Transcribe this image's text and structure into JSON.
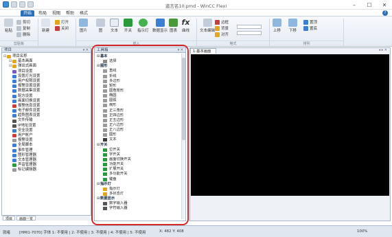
{
  "titlebar": {
    "title": "道言名10.pmd - WinCC Flexi",
    "buttons": [
      "–",
      "☐",
      "✕"
    ]
  },
  "tabs": [
    "开始",
    "布局",
    "视图",
    "帮助",
    "格式"
  ],
  "ribbon": {
    "clipboard": [
      "粘贴",
      "剪切",
      "复制",
      "删除"
    ],
    "project": [
      "新建",
      "打开",
      "关闭"
    ],
    "insert": [
      "图片",
      "图",
      "文本",
      "开关",
      "指示灯",
      "数据显示",
      "图表",
      "曲线"
    ],
    "fx": "fx",
    "format": [
      "文本编辑",
      "边框",
      "背景",
      "对齐"
    ],
    "arrange": [
      "上移",
      "下移",
      "置顶",
      "置底"
    ],
    "groups": [
      "剪贴板",
      "插入",
      "格式",
      "排列"
    ]
  },
  "left_panel": {
    "title": "项目",
    "items": [
      {
        "text": "项目名称",
        "level": 0,
        "color": "#e3a51b"
      },
      {
        "text": "基本画面",
        "level": 1,
        "color": "#e3a51b"
      },
      {
        "text": "弹出式画面",
        "level": 1,
        "color": "#e3a51b"
      },
      {
        "text": "项目设置",
        "level": 1,
        "color": "#7a5bb8"
      },
      {
        "text": "设置灯光设置",
        "level": 1,
        "color": "#3a7fd1"
      },
      {
        "text": "用户权限设置",
        "level": 1,
        "color": "#3a7fd1"
      },
      {
        "text": "报警设置设置",
        "level": 1,
        "color": "#3a7fd1"
      },
      {
        "text": "数据采集设置",
        "level": 1,
        "color": "#3a7fd1"
      },
      {
        "text": "配方设置",
        "level": 1,
        "color": "#3a7fd1"
      },
      {
        "text": "画面切换设置",
        "level": 1,
        "color": "#3a7fd1"
      },
      {
        "text": "报警信息设置",
        "level": 1,
        "color": "#c63d3d"
      },
      {
        "text": "电子邮件设置",
        "level": 1,
        "color": "#3a7fd1"
      },
      {
        "text": "趋势图表设置",
        "level": 1,
        "color": "#3a7fd1"
      },
      {
        "text": "文件传输",
        "level": 1,
        "color": "#555555"
      },
      {
        "text": "IP地址设置",
        "level": 1,
        "color": "#555555"
      },
      {
        "text": "安全设置",
        "level": 1,
        "color": "#3a7fd1"
      },
      {
        "text": "用户帐户",
        "level": 1,
        "color": "#c63d3d"
      },
      {
        "text": "报警设置",
        "level": 1,
        "color": "#999999"
      },
      {
        "text": "全局脚本",
        "level": 1,
        "color": "#3a7fd1"
      },
      {
        "text": "事件管理",
        "level": 1,
        "color": "#3a7fd1"
      },
      {
        "text": "图形管理器",
        "level": 1,
        "color": "#3a7fd1"
      },
      {
        "text": "文本管理器",
        "level": 1,
        "color": "#3a7fd1"
      },
      {
        "text": "声音管理器",
        "level": 1,
        "color": "#2a9a3a"
      },
      {
        "text": "标记编辑器",
        "level": 1,
        "color": "#999999"
      }
    ],
    "bottom_tabs": [
      "项目",
      "画面一览"
    ]
  },
  "toolbox": {
    "title": "工具箱",
    "rows": [
      {
        "text": "基本",
        "cat": true
      },
      {
        "text": "选择",
        "cat": false,
        "color": "#888888"
      },
      {
        "text": "图形",
        "cat": true
      },
      {
        "text": "直线",
        "cat": false,
        "color": "#999999"
      },
      {
        "text": "折线",
        "cat": false,
        "color": "#999999"
      },
      {
        "text": "多边形",
        "cat": false,
        "color": "#999999"
      },
      {
        "text": "矩形",
        "cat": false,
        "color": "#999999"
      },
      {
        "text": "圆角矩形",
        "cat": false,
        "color": "#999999"
      },
      {
        "text": "椭圆",
        "cat": false,
        "color": "#999999"
      },
      {
        "text": "圆弧",
        "cat": false,
        "color": "#999999"
      },
      {
        "text": "扇形",
        "cat": false,
        "color": "#999999"
      },
      {
        "text": "正三角形",
        "cat": false,
        "color": "#999999"
      },
      {
        "text": "正四边形",
        "cat": false,
        "color": "#999999"
      },
      {
        "text": "正五边形",
        "cat": false,
        "color": "#999999"
      },
      {
        "text": "正六边形",
        "cat": false,
        "color": "#999999"
      },
      {
        "text": "正八边形",
        "cat": false,
        "color": "#999999"
      },
      {
        "text": "圆形",
        "cat": false,
        "color": "#999999"
      },
      {
        "text": "文本",
        "cat": false,
        "color": "#3a3a3a"
      },
      {
        "text": "开关",
        "cat": true
      },
      {
        "text": "位开关",
        "cat": false,
        "color": "#2a9a3a"
      },
      {
        "text": "字开关",
        "cat": false,
        "color": "#2a9a3a"
      },
      {
        "text": "画面切换开关",
        "cat": false,
        "color": "#2a9a3a"
      },
      {
        "text": "功能开关",
        "cat": false,
        "color": "#2a9a3a"
      },
      {
        "text": "扩展开关",
        "cat": false,
        "color": "#2a9a3a"
      },
      {
        "text": "多功能开关",
        "cat": false,
        "color": "#2a9a3a"
      },
      {
        "text": "键盘",
        "cat": false,
        "color": "#2a9a3a"
      },
      {
        "text": "指示灯",
        "cat": true
      },
      {
        "text": "指示灯",
        "cat": false,
        "color": "#e3a51b"
      },
      {
        "text": "多状态灯",
        "cat": false,
        "color": "#e3a51b"
      },
      {
        "text": "数据显示",
        "cat": true
      },
      {
        "text": "数字输入器",
        "cat": false,
        "color": "#555555"
      },
      {
        "text": "字符输入器",
        "cat": false,
        "color": "#555555"
      }
    ]
  },
  "editor": {
    "tab": "1:基本画面",
    "ctrls": "◂ ▸ ✕"
  },
  "statusbar": {
    "left": "就绪",
    "middle": "[HMI1-7070] 字体 1: 不使用 | 2: 不使用 | 3: 不使用 | 4: 不使用 | 5: 不使用",
    "coords": "X: 482   Y: 408",
    "zoom": "100%"
  }
}
